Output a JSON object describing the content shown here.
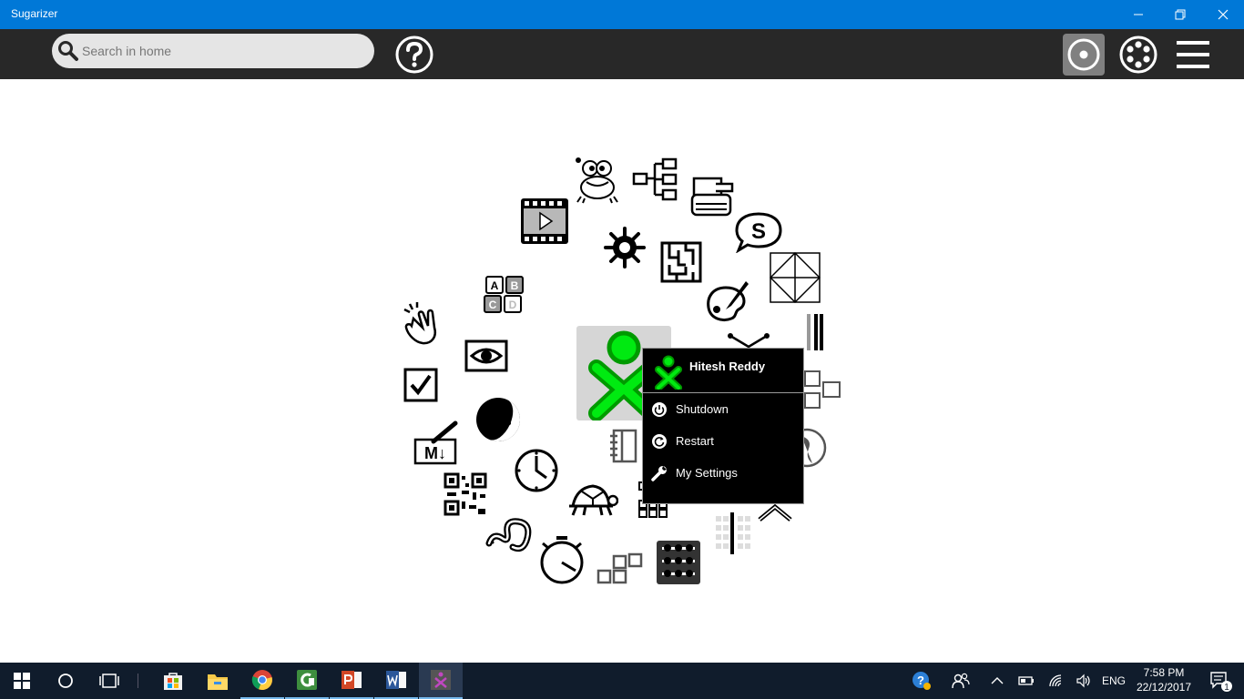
{
  "window": {
    "title": "Sugarizer",
    "controls": {
      "minimize": "—",
      "restore": "❐",
      "close": "✕"
    }
  },
  "toolbar": {
    "search": {
      "placeholder": "Search in home",
      "value": ""
    },
    "help_icon": "help-icon",
    "views": [
      "radial-view-icon",
      "neighborhood-view-icon",
      "list-view-icon"
    ]
  },
  "home": {
    "owner": {
      "name": "Hitesh Reddy",
      "stroke_color": "#00a500",
      "fill_color": "#00ea11"
    },
    "popup": {
      "items": [
        {
          "label": "Shutdown",
          "icon": "power-icon"
        },
        {
          "label": "Restart",
          "icon": "restart-icon"
        },
        {
          "label": "My Settings",
          "icon": "wrench-icon"
        }
      ]
    },
    "activity_badges": {
      "abcd": [
        "A",
        "B",
        "C",
        "D"
      ],
      "markdown": "M↓",
      "speak": "S"
    }
  },
  "taskbar": {
    "language": "ENG",
    "time": "7:58 PM",
    "date": "22/12/2017",
    "notification_count": "1",
    "apps": [
      "store",
      "file-explorer",
      "chrome",
      "camtasia",
      "powerpoint",
      "word",
      "sugarizer"
    ]
  }
}
